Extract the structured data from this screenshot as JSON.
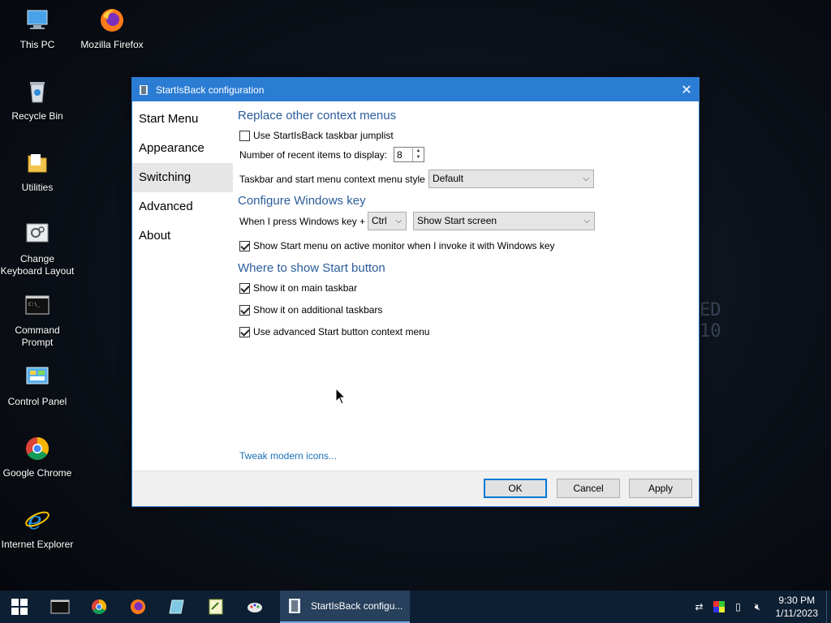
{
  "desktop": {
    "icons": [
      {
        "label": "This PC",
        "icon": "computer-icon"
      },
      {
        "label": "Mozilla Firefox",
        "icon": "firefox-icon"
      },
      {
        "label": "Recycle Bin",
        "icon": "recycle-bin-icon"
      },
      {
        "label": "Utilities",
        "icon": "folder-icon"
      },
      {
        "label": "Change Keyboard Layout",
        "icon": "keyboard-icon"
      },
      {
        "label": "Command Prompt",
        "icon": "terminal-icon"
      },
      {
        "label": "Control Panel",
        "icon": "control-panel-icon"
      },
      {
        "label": "Google Chrome",
        "icon": "chrome-icon"
      },
      {
        "label": "Internet Explorer",
        "icon": "ie-icon"
      }
    ]
  },
  "dialog": {
    "title": "StartIsBack configuration",
    "nav": [
      "Start Menu",
      "Appearance",
      "Switching",
      "Advanced",
      "About"
    ],
    "active_nav": "Switching",
    "sections": {
      "context_menus": {
        "title": "Replace other context menus",
        "jumplist_label": "Use StartIsBack taskbar jumplist",
        "jumplist_checked": false,
        "recent_label": "Number of recent items to display:",
        "recent_value": "8",
        "style_label": "Taskbar and start menu context menu style",
        "style_value": "Default"
      },
      "windows_key": {
        "title": "Configure Windows key",
        "press_label": "When I press Windows key +",
        "modifier_value": "Ctrl",
        "action_value": "Show Start screen",
        "active_monitor_label": "Show Start menu on active monitor when I invoke it with Windows key",
        "active_monitor_checked": true
      },
      "start_button": {
        "title": "Where to show Start button",
        "main_taskbar_label": "Show it on main taskbar",
        "main_taskbar_checked": true,
        "additional_label": "Show it on additional taskbars",
        "additional_checked": true,
        "advanced_menu_label": "Use advanced Start button context menu",
        "advanced_menu_checked": true
      }
    },
    "tweak_link": "Tweak modern icons...",
    "buttons": {
      "ok": "OK",
      "cancel": "Cancel",
      "apply": "Apply"
    }
  },
  "taskbar": {
    "active_window": "StartIsBack configu...",
    "pinned": [
      "terminal-icon",
      "chrome-icon",
      "firefox-icon",
      "notepad-icon",
      "editor-icon",
      "paint-icon"
    ],
    "time": "9:30 PM",
    "date": "1/11/2023"
  },
  "background_text": [
    "ED",
    "10"
  ]
}
